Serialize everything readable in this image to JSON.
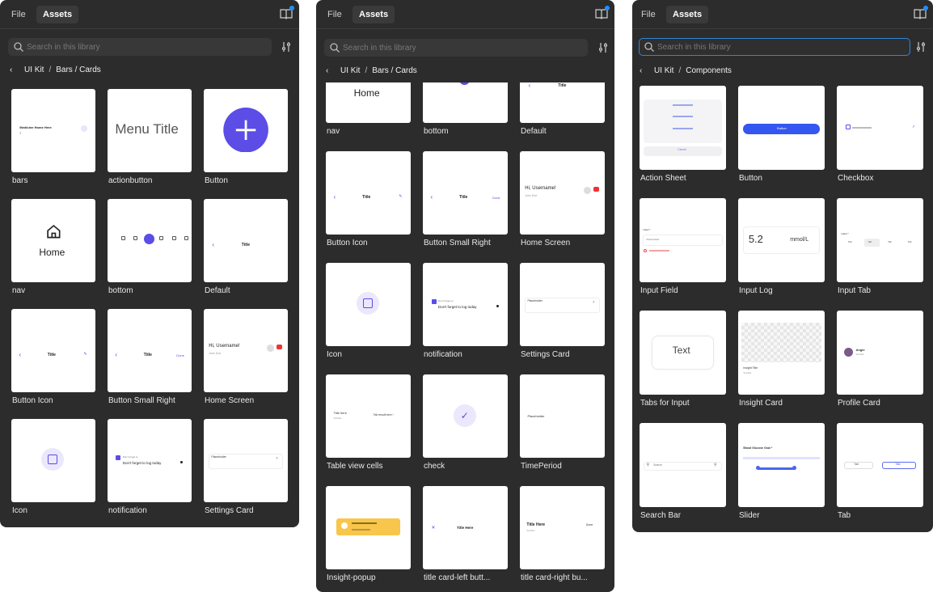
{
  "panels": [
    {
      "tabs": [
        "File",
        "Assets"
      ],
      "search_placeholder": "Search in this library",
      "breadcrumb": [
        "UI Kit",
        "Bars / Cards"
      ],
      "cards": [
        {
          "label": "bars",
          "preview": "bars"
        },
        {
          "label": "actionbutton",
          "preview": "menutitle"
        },
        {
          "label": "Button",
          "preview": "plus"
        },
        {
          "label": "nav",
          "preview": "home"
        },
        {
          "label": "bottom",
          "preview": "bottom"
        },
        {
          "label": "Default",
          "preview": "default"
        },
        {
          "label": "Button Icon",
          "preview": "buttonicon"
        },
        {
          "label": "Button Small Right",
          "preview": "smallright"
        },
        {
          "label": "Home Screen",
          "preview": "homescreen"
        },
        {
          "label": "Icon",
          "preview": "icon"
        },
        {
          "label": "notification",
          "preview": "notification"
        },
        {
          "label": "Settings Card",
          "preview": "settings"
        }
      ]
    },
    {
      "tabs": [
        "File",
        "Assets"
      ],
      "search_placeholder": "Search in this library",
      "breadcrumb": [
        "UI Kit",
        "Bars / Cards"
      ],
      "cards": [
        {
          "label": "nav",
          "preview": "home"
        },
        {
          "label": "bottom",
          "preview": "bottom"
        },
        {
          "label": "Default",
          "preview": "default"
        },
        {
          "label": "Button Icon",
          "preview": "buttonicon"
        },
        {
          "label": "Button Small Right",
          "preview": "smallright"
        },
        {
          "label": "Home Screen",
          "preview": "homescreen"
        },
        {
          "label": "Icon",
          "preview": "icon"
        },
        {
          "label": "notification",
          "preview": "notification"
        },
        {
          "label": "Settings Card",
          "preview": "settings"
        },
        {
          "label": "Table view cells",
          "preview": "tablecells"
        },
        {
          "label": "check",
          "preview": "check"
        },
        {
          "label": "TimePeriod",
          "preview": "timeperiod"
        },
        {
          "label": "Insight-popup",
          "preview": "insightpopup"
        },
        {
          "label": "title card-left butt...",
          "preview": "titleleft"
        },
        {
          "label": "title card-right bu...",
          "preview": "titleright"
        }
      ]
    },
    {
      "tabs": [
        "File",
        "Assets"
      ],
      "search_placeholder": "Search in this library",
      "breadcrumb": [
        "UI Kit",
        "Components"
      ],
      "cards": [
        {
          "label": "Action Sheet",
          "preview": "actionsheet"
        },
        {
          "label": "Button",
          "preview": "bluebutton"
        },
        {
          "label": "Checkbox",
          "preview": "checkbox"
        },
        {
          "label": "Input Field",
          "preview": "inputfield"
        },
        {
          "label": "Input Log",
          "preview": "inputlog"
        },
        {
          "label": "Input Tab",
          "preview": "inputtab"
        },
        {
          "label": "Tabs for Input",
          "preview": "tabsinput"
        },
        {
          "label": "Insight Card",
          "preview": "insightcard"
        },
        {
          "label": "Profile Card",
          "preview": "profilecard"
        },
        {
          "label": "Search Bar",
          "preview": "searchbar"
        },
        {
          "label": "Slider",
          "preview": "slider"
        },
        {
          "label": "Tab",
          "preview": "tab"
        }
      ]
    }
  ],
  "preview_text": {
    "bars_title": "Medicine Home Here",
    "menu_title": "Menu Title",
    "home": "Home",
    "title": "Title",
    "title_here": "Title Here",
    "done": "Done",
    "hi_user": "Hi, Username!",
    "subtitle_john": "John Doe",
    "notif_small": "Don't forget to",
    "notif_main": "Don't forget to log today",
    "placeholder": "Placeholder",
    "title_cell": "Title here",
    "input_log_value": "5.2",
    "input_log_unit": "mmol/L",
    "text": "Text",
    "button": "Button",
    "cancel": "Cancel",
    "search": "Search",
    "profile_name": "Angie",
    "insight_title": "Insight Title",
    "label": "Label",
    "tab": "Tab"
  },
  "colors": {
    "panel_bg": "#2c2c2c",
    "accent": "#5b4de6",
    "blue_accent": "#1f8fff",
    "focus_border": "#2f86d8",
    "popup_yellow": "#f7c64b"
  }
}
